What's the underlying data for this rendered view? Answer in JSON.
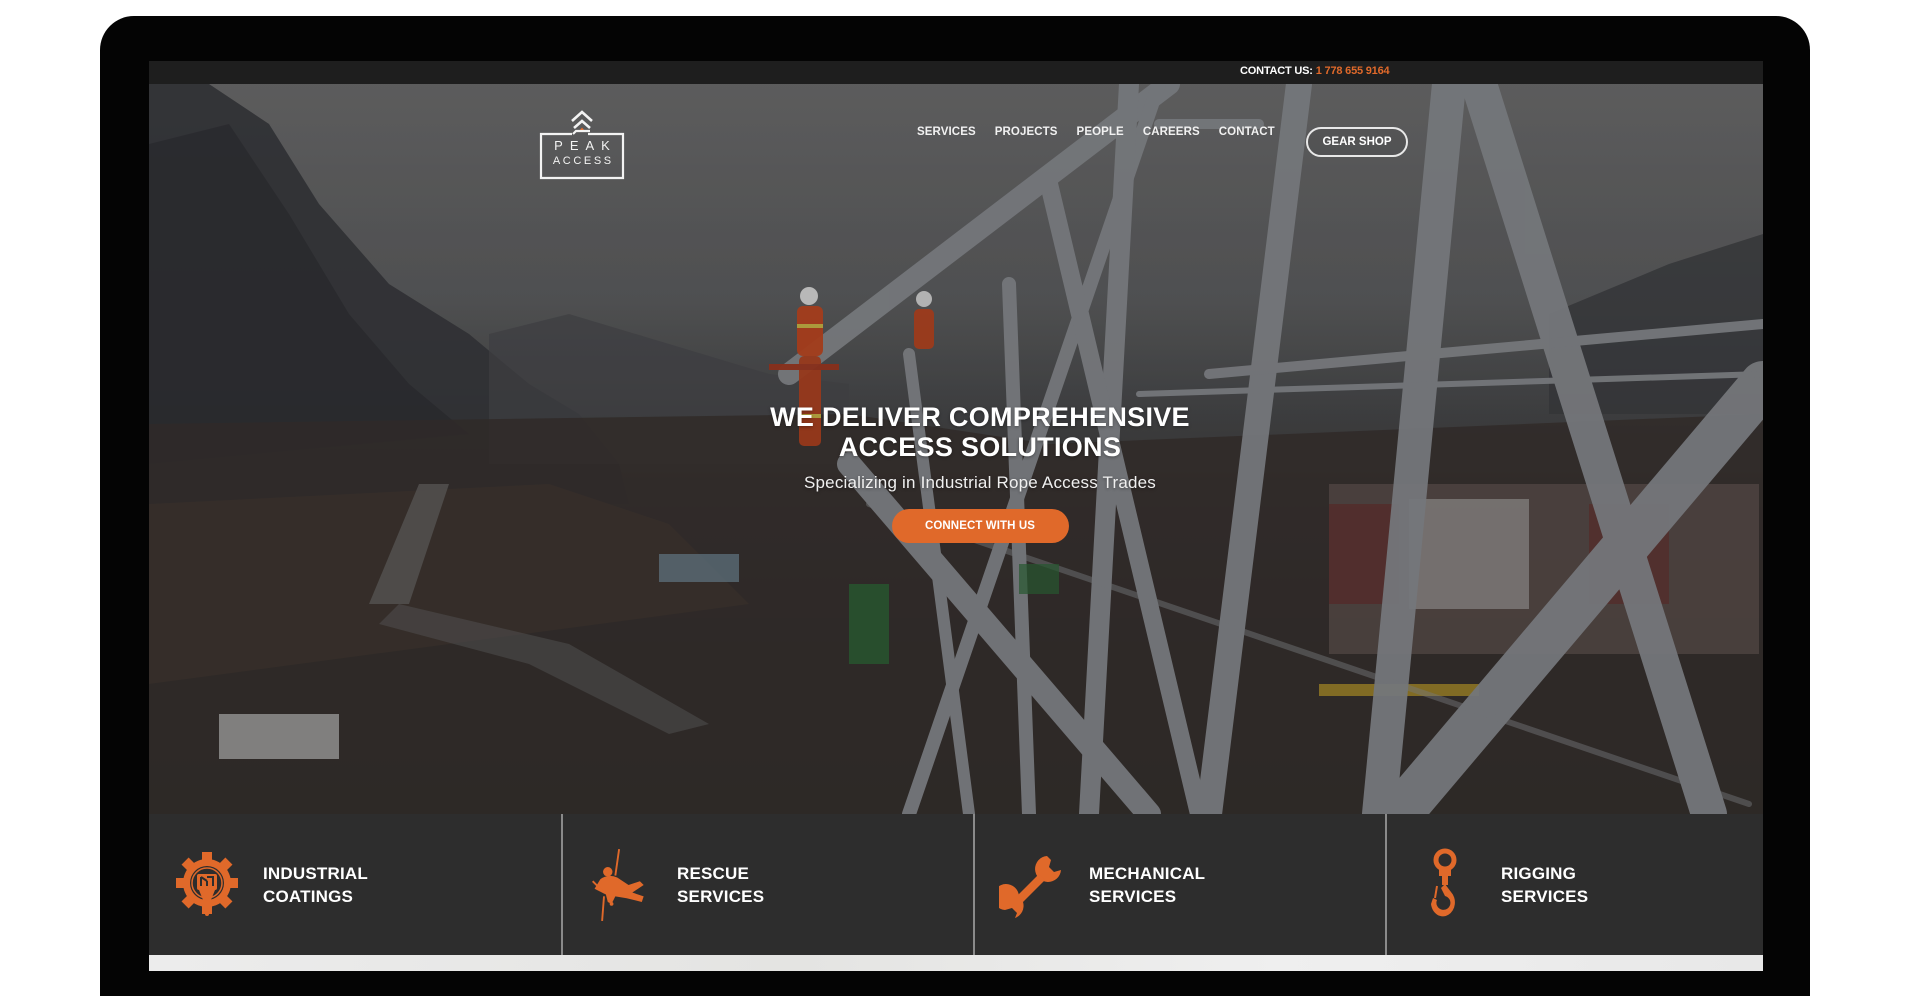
{
  "topbar": {
    "contact_label": "CONTACT US:",
    "phone": "1 778 655 9164"
  },
  "brand": {
    "line1": "PEAK",
    "line2": "ACCESS",
    "accent_color": "#e0692a"
  },
  "nav": {
    "items": [
      {
        "label": "SERVICES"
      },
      {
        "label": "PROJECTS"
      },
      {
        "label": "PEOPLE"
      },
      {
        "label": "CAREERS"
      },
      {
        "label": "CONTACT"
      }
    ],
    "gear_shop_label": "GEAR SHOP"
  },
  "hero": {
    "headline_line1": "WE DELIVER COMPREHENSIVE",
    "headline_line2": "ACCESS SOLUTIONS",
    "subtitle": "Specializing in Industrial Rope Access Trades",
    "cta_label": "CONNECT WITH US"
  },
  "services": [
    {
      "line1": "INDUSTRIAL",
      "line2": "COATINGS",
      "icon": "gear-paintbrush-icon"
    },
    {
      "line1": "RESCUE",
      "line2": "SERVICES",
      "icon": "rope-rescue-icon"
    },
    {
      "line1": "MECHANICAL",
      "line2": "SERVICES",
      "icon": "wrench-icon"
    },
    {
      "line1": "RIGGING",
      "line2": "SERVICES",
      "icon": "crane-hook-icon"
    }
  ]
}
